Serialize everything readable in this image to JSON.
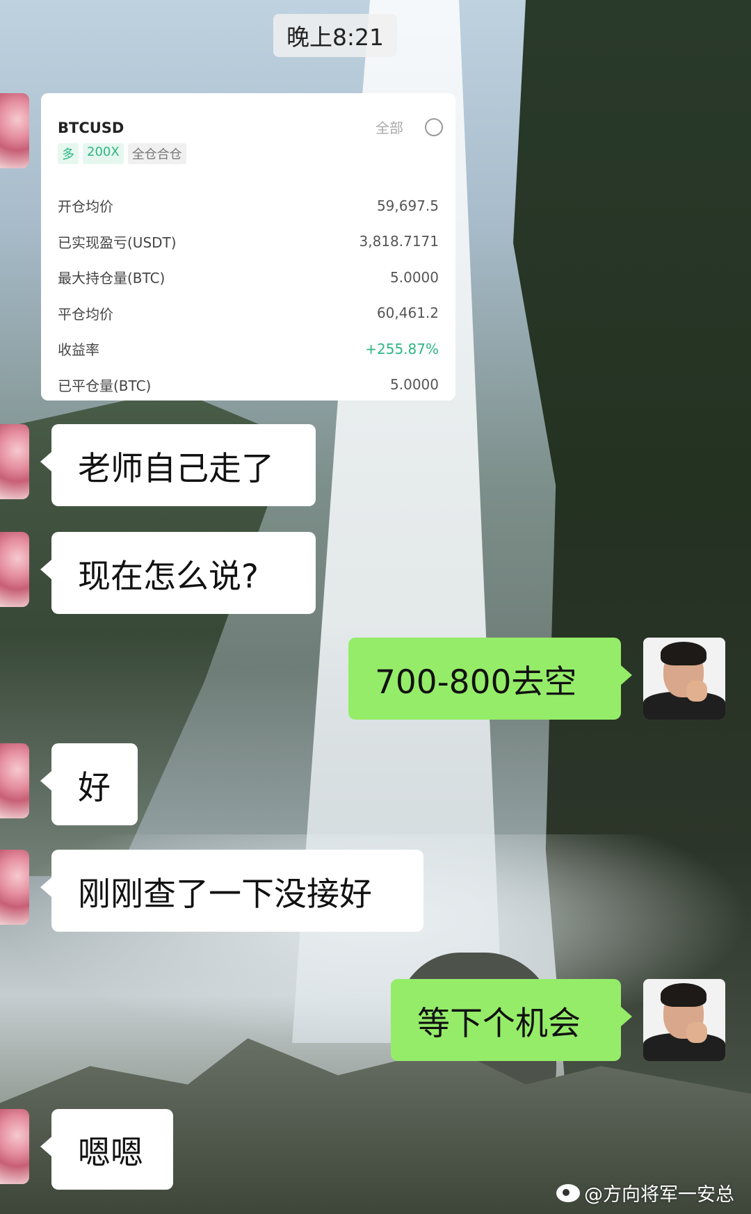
{
  "time_divider": "晚上8:21",
  "trade_card": {
    "symbol": "BTCUSD",
    "right_label": "全部",
    "tags": [
      "多",
      "200X",
      "全仓合仓"
    ],
    "rows": [
      {
        "label": "开仓均价",
        "value": "59,697.5"
      },
      {
        "label": "已实现盈亏(USDT)",
        "value": "3,818.7171"
      },
      {
        "label": "最大持仓量(BTC)",
        "value": "5.0000"
      },
      {
        "label": "平仓均价",
        "value": "60,461.2"
      },
      {
        "label": "收益率",
        "value": "+255.87%"
      },
      {
        "label": "已平仓量(BTC)",
        "value": "5.0000"
      }
    ],
    "positive_color": "#2db584"
  },
  "messages": [
    {
      "side": "left",
      "text": "老师自己走了"
    },
    {
      "side": "left",
      "text": "现在怎么说?"
    },
    {
      "side": "right",
      "text": "700-800去空"
    },
    {
      "side": "left",
      "text": "好"
    },
    {
      "side": "left",
      "text": "刚刚查了一下没接好"
    },
    {
      "side": "right",
      "text": "等下个机会"
    },
    {
      "side": "left",
      "text": "嗯嗯"
    }
  ],
  "watermark": "@方向将军一安总",
  "colors": {
    "self_bubble": "#95ec69",
    "other_bubble": "#ffffff"
  }
}
